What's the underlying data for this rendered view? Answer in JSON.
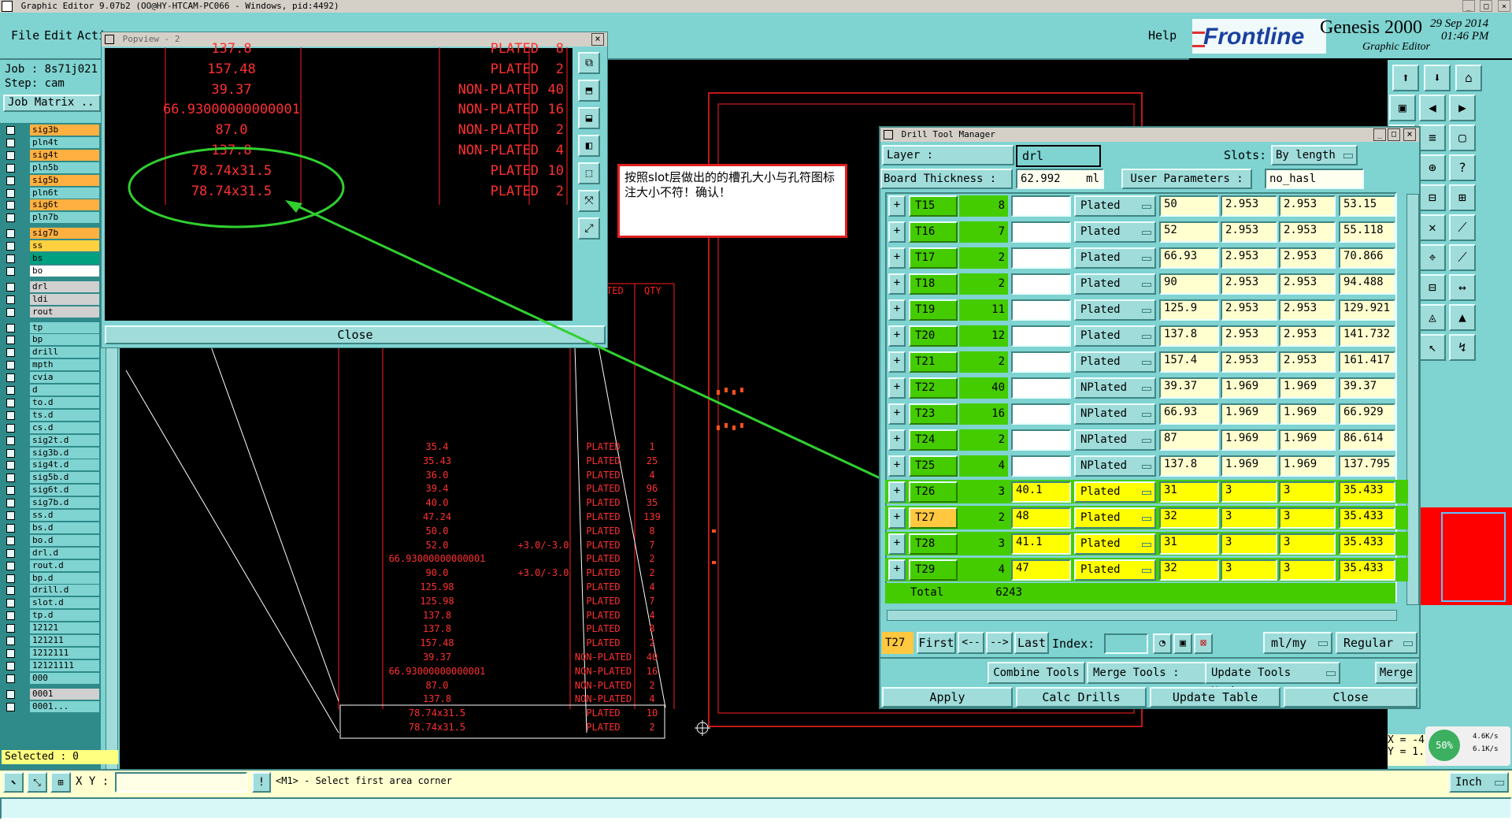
{
  "app": {
    "title": "Graphic Editor 9.07b2 (OO@HY-HTCAM-PC066 - Windows, pid:4492)",
    "menu": [
      "File",
      "Edit",
      "Acti"
    ],
    "help": "Help",
    "brand": "Frontline",
    "product": "Genesis 2000",
    "product_sub": "Graphic Editor",
    "date": "29 Sep 2014",
    "time": "01:46 PM"
  },
  "job": {
    "job_label": "Job : 8s71j021",
    "step_label": "Step: cam",
    "matrix_button": "Job Matrix ..",
    "selected": "Selected : 0"
  },
  "layers": [
    {
      "name": "sig3b",
      "color": "#ffb040"
    },
    {
      "name": "pln4t",
      "color": "#7fd3d1"
    },
    {
      "name": "sig4t",
      "color": "#ffb040"
    },
    {
      "name": "pln5b",
      "color": "#7fd3d1"
    },
    {
      "name": "sig5b",
      "color": "#ffb040"
    },
    {
      "name": "pln6t",
      "color": "#7fd3d1"
    },
    {
      "name": "sig6t",
      "color": "#ffb040"
    },
    {
      "name": "pln7b",
      "color": "#7fd3d1"
    },
    {
      "name": "sig7b",
      "color": "#ffb040"
    },
    {
      "name": "ss",
      "color": "#ffd040"
    },
    {
      "name": "bs",
      "color": "#00a080"
    },
    {
      "name": "bo",
      "color": "#ffffff"
    },
    {
      "name": "drl",
      "color": "#d0d0d0"
    },
    {
      "name": "ldi",
      "color": "#d0d0d0"
    },
    {
      "name": "rout",
      "color": "#d0d0d0"
    },
    {
      "name": "tp",
      "color": "#7fd3d1"
    },
    {
      "name": "bp",
      "color": "#7fd3d1"
    },
    {
      "name": "drill",
      "color": "#7fd3d1"
    },
    {
      "name": "mpth",
      "color": "#7fd3d1"
    },
    {
      "name": "cvia",
      "color": "#7fd3d1"
    },
    {
      "name": "d",
      "color": "#7fd3d1"
    },
    {
      "name": "to.d",
      "color": "#7fd3d1"
    },
    {
      "name": "ts.d",
      "color": "#7fd3d1"
    },
    {
      "name": "cs.d",
      "color": "#7fd3d1"
    },
    {
      "name": "sig2t.d",
      "color": "#7fd3d1"
    },
    {
      "name": "sig3b.d",
      "color": "#7fd3d1"
    },
    {
      "name": "sig4t.d",
      "color": "#7fd3d1"
    },
    {
      "name": "sig5b.d",
      "color": "#7fd3d1"
    },
    {
      "name": "sig6t.d",
      "color": "#7fd3d1"
    },
    {
      "name": "sig7b.d",
      "color": "#7fd3d1"
    },
    {
      "name": "ss.d",
      "color": "#7fd3d1"
    },
    {
      "name": "bs.d",
      "color": "#7fd3d1"
    },
    {
      "name": "bo.d",
      "color": "#7fd3d1"
    },
    {
      "name": "drl.d",
      "color": "#7fd3d1"
    },
    {
      "name": "rout.d",
      "color": "#7fd3d1"
    },
    {
      "name": "bp.d",
      "color": "#7fd3d1"
    },
    {
      "name": "drill.d",
      "color": "#7fd3d1"
    },
    {
      "name": "slot.d",
      "color": "#7fd3d1"
    },
    {
      "name": "tp.d",
      "color": "#7fd3d1"
    },
    {
      "name": "12121",
      "color": "#7fd3d1"
    },
    {
      "name": "121211",
      "color": "#7fd3d1"
    },
    {
      "name": "1212111",
      "color": "#7fd3d1"
    },
    {
      "name": "12121111",
      "color": "#7fd3d1"
    },
    {
      "name": "000",
      "color": "#7fd3d1"
    },
    {
      "name": "0001",
      "color": "#d0d0d0"
    },
    {
      "name": "0001...",
      "color": "#7fd3d1"
    }
  ],
  "popview": {
    "title": "Popview - 2",
    "rows": [
      {
        "size": "137.8",
        "type": "PLATED",
        "qty": "8"
      },
      {
        "size": "157.48",
        "type": "PLATED",
        "qty": "2"
      },
      {
        "size": "39.37",
        "type": "NON-PLATED",
        "qty": "40"
      },
      {
        "size": "66.93000000000001",
        "type": "NON-PLATED",
        "qty": "16"
      },
      {
        "size": "87.0",
        "type": "NON-PLATED",
        "qty": "2"
      },
      {
        "size": "137.8",
        "type": "NON-PLATED",
        "qty": "4"
      },
      {
        "size": "78.74x31.5",
        "type": "PLATED",
        "qty": "10"
      },
      {
        "size": "78.74x31.5",
        "type": "PLATED",
        "qty": "2"
      }
    ],
    "close": "Close"
  },
  "note": {
    "text": "按照slot层做出的的槽孔大小与孔符图标注大小不符！确认！"
  },
  "board_table": {
    "header_type": "TED",
    "header_qty": "QTY",
    "rows": [
      {
        "size": "35.4",
        "tol": "",
        "type": "PLATED",
        "qty": "1"
      },
      {
        "size": "35.43",
        "tol": "",
        "type": "PLATED",
        "qty": "25"
      },
      {
        "size": "36.0",
        "tol": "",
        "type": "PLATED",
        "qty": "4"
      },
      {
        "size": "39.4",
        "tol": "",
        "type": "PLATED",
        "qty": "96"
      },
      {
        "size": "40.0",
        "tol": "",
        "type": "PLATED",
        "qty": "35"
      },
      {
        "size": "47.24",
        "tol": "",
        "type": "PLATED",
        "qty": "139"
      },
      {
        "size": "50.0",
        "tol": "",
        "type": "PLATED",
        "qty": "8"
      },
      {
        "size": "52.0",
        "tol": "+3.0/-3.0",
        "type": "PLATED",
        "qty": "7"
      },
      {
        "size": "66.93000000000001",
        "tol": "",
        "type": "PLATED",
        "qty": "2"
      },
      {
        "size": "90.0",
        "tol": "+3.0/-3.0",
        "type": "PLATED",
        "qty": "2"
      },
      {
        "size": "125.98",
        "tol": "",
        "type": "PLATED",
        "qty": "4"
      },
      {
        "size": "125.98",
        "tol": "",
        "type": "PLATED",
        "qty": "7"
      },
      {
        "size": "137.8",
        "tol": "",
        "type": "PLATED",
        "qty": "4"
      },
      {
        "size": "137.8",
        "tol": "",
        "type": "PLATED",
        "qty": "8"
      },
      {
        "size": "157.48",
        "tol": "",
        "type": "PLATED",
        "qty": "2"
      },
      {
        "size": "39.37",
        "tol": "",
        "type": "NON-PLATED",
        "qty": "40"
      },
      {
        "size": "66.93000000000001",
        "tol": "",
        "type": "NON-PLATED",
        "qty": "16"
      },
      {
        "size": "87.0",
        "tol": "",
        "type": "NON-PLATED",
        "qty": "2"
      },
      {
        "size": "137.8",
        "tol": "",
        "type": "NON-PLATED",
        "qty": "4"
      },
      {
        "size": "78.74x31.5",
        "tol": "",
        "type": "PLATED",
        "qty": "10"
      },
      {
        "size": "78.74x31.5",
        "tol": "",
        "type": "PLATED",
        "qty": "2"
      }
    ]
  },
  "dtm": {
    "title": "Drill Tool Manager",
    "layer_label": "Layer                :",
    "layer_value": "drl",
    "slots_label": "Slots:",
    "slots_value": "By length",
    "thickness_label": "Board Thickness :",
    "thickness_value": "62.992",
    "thickness_unit": "ml",
    "user_params_label": "User Parameters :",
    "user_params_value": "no_hasl",
    "rows": [
      {
        "tool": "T15",
        "count": "8",
        "type": "Plated",
        "size": "50",
        "p1": "2.953",
        "p2": "2.953",
        "fin": "53.15",
        "hl": false
      },
      {
        "tool": "T16",
        "count": "7",
        "type": "Plated",
        "size": "52",
        "p1": "2.953",
        "p2": "2.953",
        "fin": "55.118",
        "hl": false
      },
      {
        "tool": "T17",
        "count": "2",
        "type": "Plated",
        "size": "66.93",
        "p1": "2.953",
        "p2": "2.953",
        "fin": "70.866",
        "hl": false
      },
      {
        "tool": "T18",
        "count": "2",
        "type": "Plated",
        "size": "90",
        "p1": "2.953",
        "p2": "2.953",
        "fin": "94.488",
        "hl": false
      },
      {
        "tool": "T19",
        "count": "11",
        "type": "Plated",
        "size": "125.9",
        "p1": "2.953",
        "p2": "2.953",
        "fin": "129.921",
        "hl": false
      },
      {
        "tool": "T20",
        "count": "12",
        "type": "Plated",
        "size": "137.8",
        "p1": "2.953",
        "p2": "2.953",
        "fin": "141.732",
        "hl": false
      },
      {
        "tool": "T21",
        "count": "2",
        "type": "Plated",
        "size": "157.4",
        "p1": "2.953",
        "p2": "2.953",
        "fin": "161.417",
        "hl": false
      },
      {
        "tool": "T22",
        "count": "40",
        "type": "NPlated",
        "size": "39.37",
        "p1": "1.969",
        "p2": "1.969",
        "fin": "39.37",
        "hl": false
      },
      {
        "tool": "T23",
        "count": "16",
        "type": "NPlated",
        "size": "66.93",
        "p1": "1.969",
        "p2": "1.969",
        "fin": "66.929",
        "hl": false
      },
      {
        "tool": "T24",
        "count": "2",
        "type": "NPlated",
        "size": "87",
        "p1": "1.969",
        "p2": "1.969",
        "fin": "86.614",
        "hl": false
      },
      {
        "tool": "T25",
        "count": "4",
        "type": "NPlated",
        "size": "137.8",
        "p1": "1.969",
        "p2": "1.969",
        "fin": "137.795",
        "hl": false
      },
      {
        "tool": "T26",
        "count": "3",
        "type": "Plated",
        "slot": "40.1",
        "size": "31",
        "p1": "3",
        "p2": "3",
        "fin": "35.433",
        "hl": true
      },
      {
        "tool": "T27",
        "count": "2",
        "type": "Plated",
        "slot": "48",
        "size": "32",
        "p1": "3",
        "p2": "3",
        "fin": "35.433",
        "hl": true,
        "sel": true
      },
      {
        "tool": "T28",
        "count": "3",
        "type": "Plated",
        "slot": "41.1",
        "size": "31",
        "p1": "3",
        "p2": "3",
        "fin": "35.433",
        "hl": true
      },
      {
        "tool": "T29",
        "count": "4",
        "type": "Plated",
        "slot": "47",
        "size": "32",
        "p1": "3",
        "p2": "3",
        "fin": "35.433",
        "hl": true
      }
    ],
    "total_label": "Total",
    "total_value": "6243",
    "current_tool": "T27",
    "nav": {
      "first": "First",
      "prev": "<--",
      "next": "-->",
      "last": "Last",
      "index": "Index:"
    },
    "units": "ml/my",
    "mode": "Regular",
    "combine": "Combine Tools",
    "merge_tools": "Merge Tools :",
    "update_numbers": "Update Tools Numbers",
    "merge": "Merge",
    "apply": "Apply",
    "calc": "Calc Drills",
    "update_table": "Update Table",
    "close": "Close"
  },
  "status": {
    "xy_label": "X Y :",
    "prompt": "<M1> - Select first area corner",
    "unit": "Inch",
    "coord_x": "X = -4",
    "coord_y": "Y = 1.",
    "net_pct": "50%",
    "net_up": "4.6K/s",
    "net_down": "6.1K/s"
  },
  "colors": {
    "teal": "#7fd3d1",
    "yellow": "#ffff00",
    "green": "#44cc00",
    "red": "#ff2020"
  }
}
